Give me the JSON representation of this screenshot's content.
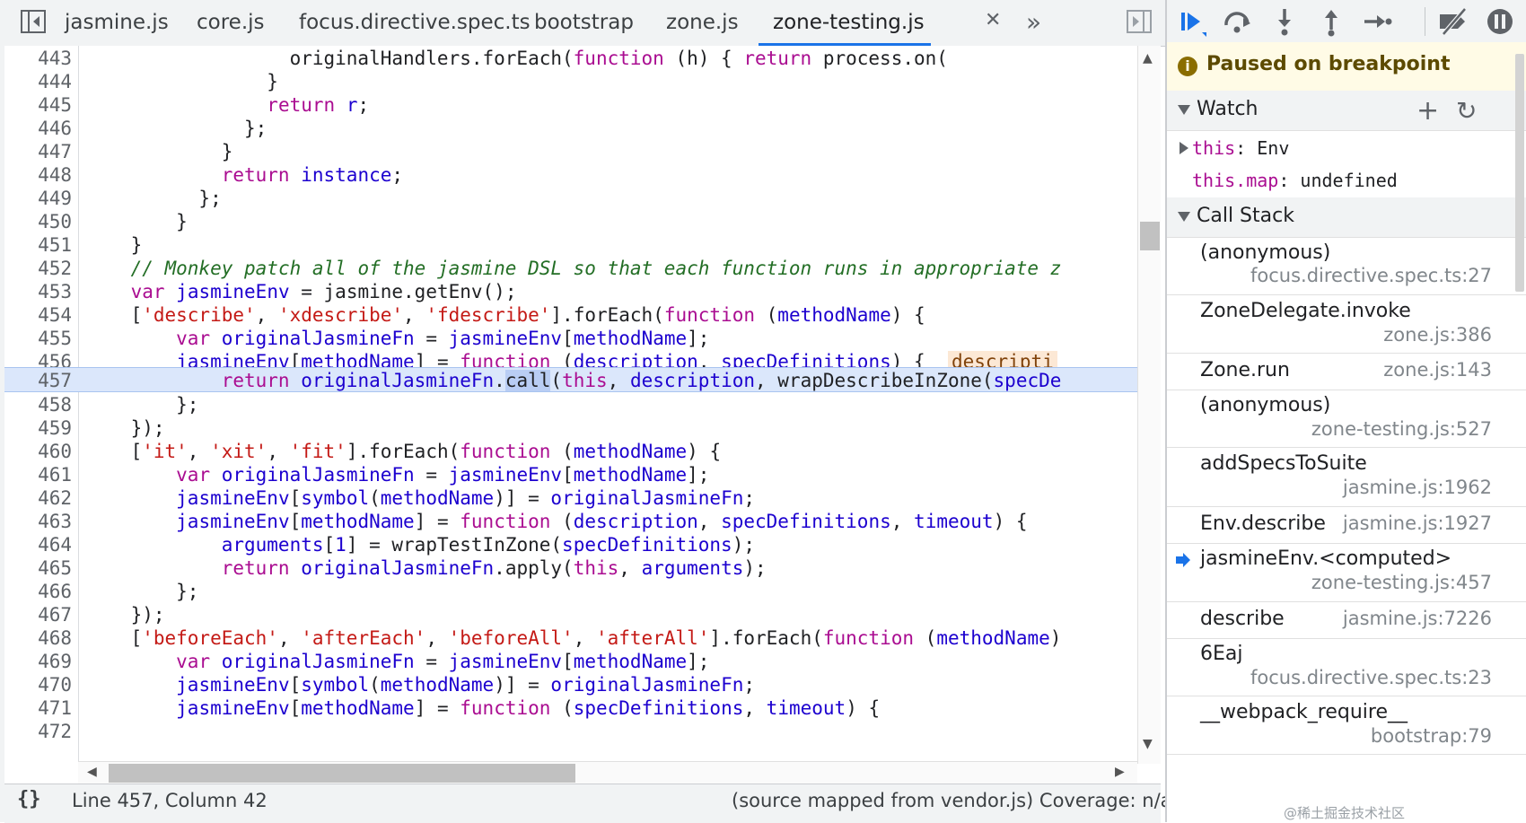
{
  "tabs": [
    {
      "label": "jasmine.js"
    },
    {
      "label": "core.js"
    },
    {
      "label": "focus.directive.spec.ts"
    },
    {
      "label": "bootstrap"
    },
    {
      "label": "zone.js"
    },
    {
      "label": "zone-testing.js"
    }
  ],
  "tab_more_icon": "chevron-double-right-icon",
  "editor": {
    "line_numbers": [
      "443",
      "444",
      "445",
      "446",
      "447",
      "448",
      "449",
      "450",
      "451",
      "452",
      "453",
      "454",
      "455",
      "456",
      "457",
      "458",
      "459",
      "460",
      "461",
      "462",
      "463",
      "464",
      "465",
      "466",
      "467",
      "468",
      "469",
      "470",
      "471",
      "472"
    ],
    "paused_line": "457",
    "inline_value": "descripti"
  },
  "statusbar": {
    "format_label": "{}",
    "cursor_position": "Line 457, Column 42",
    "source_info": "(source mapped from vendor.js)  Coverage: n/a"
  },
  "debugger": {
    "paused_message": "Paused on breakpoint",
    "watch": {
      "title": "Watch",
      "items": [
        {
          "expr": "this",
          "value": "Env"
        },
        {
          "expr": "this.map",
          "value": "undefined"
        }
      ]
    },
    "call_stack": {
      "title": "Call Stack",
      "frames": [
        {
          "name": "(anonymous)",
          "location": "focus.directive.spec.ts:27"
        },
        {
          "name": "ZoneDelegate.invoke",
          "location": "zone.js:386"
        },
        {
          "name": "Zone.run",
          "location": "zone.js:143"
        },
        {
          "name": "(anonymous)",
          "location": "zone-testing.js:527"
        },
        {
          "name": "addSpecsToSuite",
          "location": "jasmine.js:1962"
        },
        {
          "name": "Env.describe",
          "location": "jasmine.js:1927"
        },
        {
          "name": "jasmineEnv.<computed>",
          "location": "zone-testing.js:457"
        },
        {
          "name": "describe",
          "location": "jasmine.js:7226"
        },
        {
          "name": "6Eaj",
          "location": "focus.directive.spec.ts:23"
        },
        {
          "name": "__webpack_require__",
          "location": "bootstrap:79"
        }
      ]
    }
  },
  "watermark": "@稀土掘金技术社区",
  "colors": {
    "accent": "#1a73e8",
    "paused_line_bg": "#dbe7fb",
    "keyword": "#aa0d91",
    "string": "#c41a16",
    "comment": "#236e25"
  }
}
